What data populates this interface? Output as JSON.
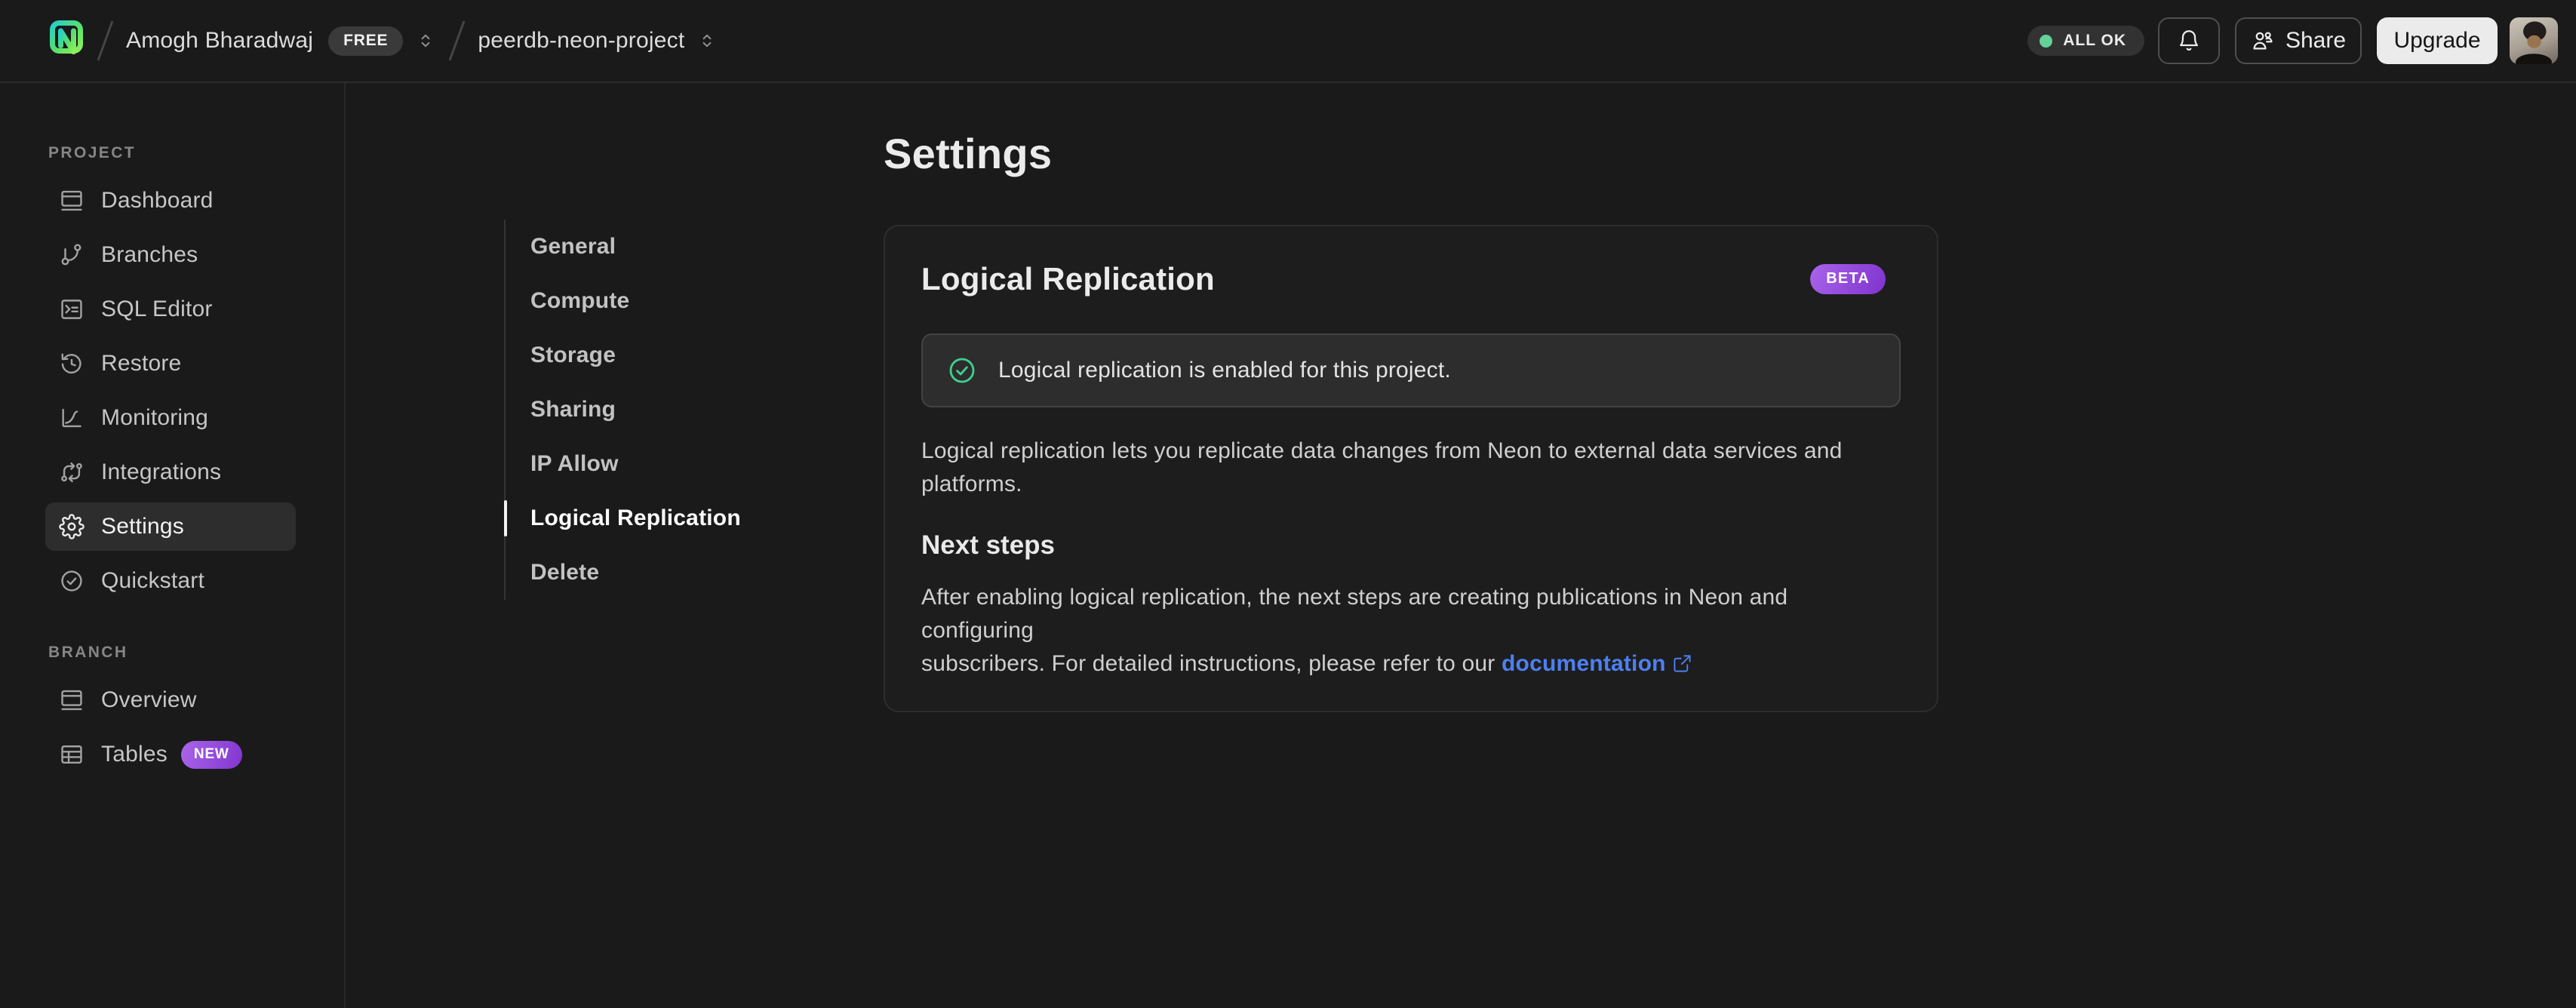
{
  "header": {
    "breadcrumb": {
      "org_name": "Amogh Bharadwaj",
      "org_badge": "FREE",
      "project_name": "peerdb-neon-project"
    },
    "status_pill": "ALL OK",
    "share_label": "Share",
    "upgrade_label": "Upgrade"
  },
  "sidebar": {
    "project_section_label": "PROJECT",
    "project_items": [
      {
        "label": "Dashboard",
        "icon": "dashboard-icon",
        "active": false
      },
      {
        "label": "Branches",
        "icon": "branches-icon",
        "active": false
      },
      {
        "label": "SQL Editor",
        "icon": "sql-editor-icon",
        "active": false
      },
      {
        "label": "Restore",
        "icon": "restore-icon",
        "active": false
      },
      {
        "label": "Monitoring",
        "icon": "monitoring-icon",
        "active": false
      },
      {
        "label": "Integrations",
        "icon": "integrations-icon",
        "active": false
      },
      {
        "label": "Settings",
        "icon": "settings-icon",
        "active": true
      },
      {
        "label": "Quickstart",
        "icon": "quickstart-icon",
        "active": false
      }
    ],
    "branch_section_label": "BRANCH",
    "branch_items": [
      {
        "label": "Overview",
        "icon": "overview-icon",
        "active": false
      },
      {
        "label": "Tables",
        "icon": "tables-icon",
        "active": false,
        "badge": "NEW"
      }
    ]
  },
  "settings_nav": {
    "items": [
      {
        "label": "General",
        "active": false
      },
      {
        "label": "Compute",
        "active": false
      },
      {
        "label": "Storage",
        "active": false
      },
      {
        "label": "Sharing",
        "active": false
      },
      {
        "label": "IP Allow",
        "active": false
      },
      {
        "label": "Logical Replication",
        "active": true
      },
      {
        "label": "Delete",
        "active": false
      }
    ]
  },
  "main": {
    "page_title": "Settings",
    "card": {
      "title": "Logical Replication",
      "badge": "BETA",
      "banner_text": "Logical replication is enabled for this project.",
      "description": "Logical replication lets you replicate data changes from Neon to external data services and\nplatforms.",
      "next_steps_title": "Next steps",
      "next_steps_text": "After enabling logical replication, the next steps are creating publications in Neon and configuring\nsubscribers. For detailed instructions, please refer to our ",
      "doc_link_label": "documentation"
    }
  },
  "colors": {
    "background": "#1a1a1a",
    "card_background": "#1d1d1d",
    "banner_background": "#2d2d2d",
    "border": "#2d2d2d",
    "success_green": "#3fd08e",
    "status_dot_green": "#63d297",
    "badge_purple_start": "#a964ea",
    "badge_purple_end": "#7f33ce",
    "link_blue": "#4d80f0",
    "logo_gradient_start": "#26d0c7",
    "logo_gradient_end": "#8df05a"
  }
}
